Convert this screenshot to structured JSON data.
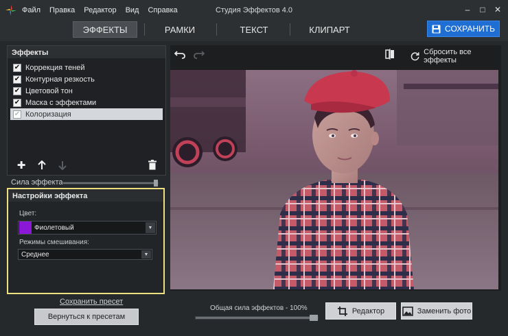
{
  "window": {
    "title": "Студия Эффектов 4.0",
    "controls": {
      "minimize": "–",
      "maximize": "□",
      "close": "✕"
    }
  },
  "menu": [
    "Файл",
    "Правка",
    "Редактор",
    "Вид",
    "Справка"
  ],
  "tabs": [
    {
      "label": "ЭФФЕКТЫ",
      "active": true
    },
    {
      "label": "РАМКИ",
      "active": false
    },
    {
      "label": "ТЕКСТ",
      "active": false
    },
    {
      "label": "КЛИПАРТ",
      "active": false
    }
  ],
  "save_button": {
    "label": "СОХРАНИТЬ",
    "icon": "floppy-disk-icon"
  },
  "effects_panel": {
    "title": "Эффекты",
    "items": [
      {
        "label": "Коррекция теней",
        "checked": true,
        "selected": false
      },
      {
        "label": "Контурная резкость",
        "checked": true,
        "selected": false
      },
      {
        "label": "Цветовой тон",
        "checked": true,
        "selected": false
      },
      {
        "label": "Маска с эффектами",
        "checked": true,
        "selected": false
      },
      {
        "label": "Колоризация",
        "checked": true,
        "selected": true
      }
    ],
    "tools": [
      "add-icon",
      "move-up-icon",
      "move-down-icon",
      "trash-icon"
    ]
  },
  "effect_strength": {
    "label": "Сила эффекта",
    "value_fraction": 1.0
  },
  "effect_settings": {
    "title": "Настройки эффекта",
    "color_label": "Цвет:",
    "color_value": "Фиолетовый",
    "color_swatch": "#8a18d6",
    "blend_label": "Режимы смешивания:",
    "blend_value": "Среднее"
  },
  "save_preset_link": "Сохранить пресет",
  "back_to_presets_button": "Вернуться к пресетам",
  "canvas_toolbar": {
    "reset_all_label": "Сбросить все эффекты",
    "icons": [
      "undo-icon",
      "redo-icon",
      "compare-icon",
      "reset-icon"
    ]
  },
  "overall_strength": {
    "label": "Общая сила эффектов - 100%",
    "value_fraction": 1.0
  },
  "editor_button": "Редактор",
  "replace_photo_button": "Заменить фото",
  "colors": {
    "accent_blue": "#1e6ed3",
    "highlight_border": "#efe082",
    "background": "#26292c"
  }
}
